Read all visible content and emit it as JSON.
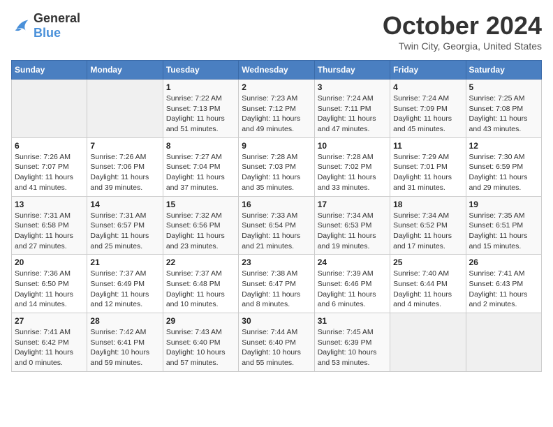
{
  "header": {
    "logo_general": "General",
    "logo_blue": "Blue",
    "month": "October 2024",
    "location": "Twin City, Georgia, United States"
  },
  "weekdays": [
    "Sunday",
    "Monday",
    "Tuesday",
    "Wednesday",
    "Thursday",
    "Friday",
    "Saturday"
  ],
  "weeks": [
    [
      {
        "day": "",
        "empty": true
      },
      {
        "day": "",
        "empty": true
      },
      {
        "day": "1",
        "sunrise": "Sunrise: 7:22 AM",
        "sunset": "Sunset: 7:13 PM",
        "daylight": "Daylight: 11 hours and 51 minutes."
      },
      {
        "day": "2",
        "sunrise": "Sunrise: 7:23 AM",
        "sunset": "Sunset: 7:12 PM",
        "daylight": "Daylight: 11 hours and 49 minutes."
      },
      {
        "day": "3",
        "sunrise": "Sunrise: 7:24 AM",
        "sunset": "Sunset: 7:11 PM",
        "daylight": "Daylight: 11 hours and 47 minutes."
      },
      {
        "day": "4",
        "sunrise": "Sunrise: 7:24 AM",
        "sunset": "Sunset: 7:09 PM",
        "daylight": "Daylight: 11 hours and 45 minutes."
      },
      {
        "day": "5",
        "sunrise": "Sunrise: 7:25 AM",
        "sunset": "Sunset: 7:08 PM",
        "daylight": "Daylight: 11 hours and 43 minutes."
      }
    ],
    [
      {
        "day": "6",
        "sunrise": "Sunrise: 7:26 AM",
        "sunset": "Sunset: 7:07 PM",
        "daylight": "Daylight: 11 hours and 41 minutes."
      },
      {
        "day": "7",
        "sunrise": "Sunrise: 7:26 AM",
        "sunset": "Sunset: 7:06 PM",
        "daylight": "Daylight: 11 hours and 39 minutes."
      },
      {
        "day": "8",
        "sunrise": "Sunrise: 7:27 AM",
        "sunset": "Sunset: 7:04 PM",
        "daylight": "Daylight: 11 hours and 37 minutes."
      },
      {
        "day": "9",
        "sunrise": "Sunrise: 7:28 AM",
        "sunset": "Sunset: 7:03 PM",
        "daylight": "Daylight: 11 hours and 35 minutes."
      },
      {
        "day": "10",
        "sunrise": "Sunrise: 7:28 AM",
        "sunset": "Sunset: 7:02 PM",
        "daylight": "Daylight: 11 hours and 33 minutes."
      },
      {
        "day": "11",
        "sunrise": "Sunrise: 7:29 AM",
        "sunset": "Sunset: 7:01 PM",
        "daylight": "Daylight: 11 hours and 31 minutes."
      },
      {
        "day": "12",
        "sunrise": "Sunrise: 7:30 AM",
        "sunset": "Sunset: 6:59 PM",
        "daylight": "Daylight: 11 hours and 29 minutes."
      }
    ],
    [
      {
        "day": "13",
        "sunrise": "Sunrise: 7:31 AM",
        "sunset": "Sunset: 6:58 PM",
        "daylight": "Daylight: 11 hours and 27 minutes."
      },
      {
        "day": "14",
        "sunrise": "Sunrise: 7:31 AM",
        "sunset": "Sunset: 6:57 PM",
        "daylight": "Daylight: 11 hours and 25 minutes."
      },
      {
        "day": "15",
        "sunrise": "Sunrise: 7:32 AM",
        "sunset": "Sunset: 6:56 PM",
        "daylight": "Daylight: 11 hours and 23 minutes."
      },
      {
        "day": "16",
        "sunrise": "Sunrise: 7:33 AM",
        "sunset": "Sunset: 6:54 PM",
        "daylight": "Daylight: 11 hours and 21 minutes."
      },
      {
        "day": "17",
        "sunrise": "Sunrise: 7:34 AM",
        "sunset": "Sunset: 6:53 PM",
        "daylight": "Daylight: 11 hours and 19 minutes."
      },
      {
        "day": "18",
        "sunrise": "Sunrise: 7:34 AM",
        "sunset": "Sunset: 6:52 PM",
        "daylight": "Daylight: 11 hours and 17 minutes."
      },
      {
        "day": "19",
        "sunrise": "Sunrise: 7:35 AM",
        "sunset": "Sunset: 6:51 PM",
        "daylight": "Daylight: 11 hours and 15 minutes."
      }
    ],
    [
      {
        "day": "20",
        "sunrise": "Sunrise: 7:36 AM",
        "sunset": "Sunset: 6:50 PM",
        "daylight": "Daylight: 11 hours and 14 minutes."
      },
      {
        "day": "21",
        "sunrise": "Sunrise: 7:37 AM",
        "sunset": "Sunset: 6:49 PM",
        "daylight": "Daylight: 11 hours and 12 minutes."
      },
      {
        "day": "22",
        "sunrise": "Sunrise: 7:37 AM",
        "sunset": "Sunset: 6:48 PM",
        "daylight": "Daylight: 11 hours and 10 minutes."
      },
      {
        "day": "23",
        "sunrise": "Sunrise: 7:38 AM",
        "sunset": "Sunset: 6:47 PM",
        "daylight": "Daylight: 11 hours and 8 minutes."
      },
      {
        "day": "24",
        "sunrise": "Sunrise: 7:39 AM",
        "sunset": "Sunset: 6:46 PM",
        "daylight": "Daylight: 11 hours and 6 minutes."
      },
      {
        "day": "25",
        "sunrise": "Sunrise: 7:40 AM",
        "sunset": "Sunset: 6:44 PM",
        "daylight": "Daylight: 11 hours and 4 minutes."
      },
      {
        "day": "26",
        "sunrise": "Sunrise: 7:41 AM",
        "sunset": "Sunset: 6:43 PM",
        "daylight": "Daylight: 11 hours and 2 minutes."
      }
    ],
    [
      {
        "day": "27",
        "sunrise": "Sunrise: 7:41 AM",
        "sunset": "Sunset: 6:42 PM",
        "daylight": "Daylight: 11 hours and 0 minutes."
      },
      {
        "day": "28",
        "sunrise": "Sunrise: 7:42 AM",
        "sunset": "Sunset: 6:41 PM",
        "daylight": "Daylight: 10 hours and 59 minutes."
      },
      {
        "day": "29",
        "sunrise": "Sunrise: 7:43 AM",
        "sunset": "Sunset: 6:40 PM",
        "daylight": "Daylight: 10 hours and 57 minutes."
      },
      {
        "day": "30",
        "sunrise": "Sunrise: 7:44 AM",
        "sunset": "Sunset: 6:40 PM",
        "daylight": "Daylight: 10 hours and 55 minutes."
      },
      {
        "day": "31",
        "sunrise": "Sunrise: 7:45 AM",
        "sunset": "Sunset: 6:39 PM",
        "daylight": "Daylight: 10 hours and 53 minutes."
      },
      {
        "day": "",
        "empty": true
      },
      {
        "day": "",
        "empty": true
      }
    ]
  ]
}
